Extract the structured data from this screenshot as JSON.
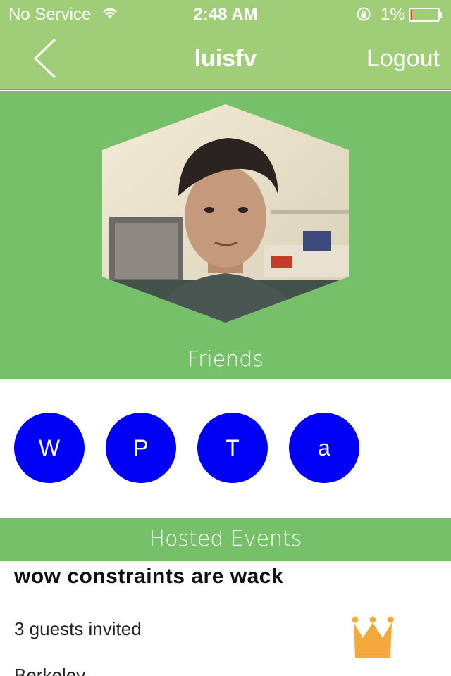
{
  "status_bar": {
    "carrier": "No Service",
    "time": "2:48 AM",
    "battery_percent": "1%",
    "icons": [
      "wifi-icon",
      "lock-rotation-icon",
      "battery-icon"
    ],
    "battery_level": 0.01,
    "battery_color": "#ff3b30"
  },
  "nav": {
    "back_icon": "back-chevron-icon",
    "title": "luisfv",
    "logout_label": "Logout"
  },
  "profile": {
    "avatar_shape": "hexagon"
  },
  "friends": {
    "heading": "Friends",
    "items": [
      {
        "initial": "W"
      },
      {
        "initial": "P"
      },
      {
        "initial": "T"
      },
      {
        "initial": "a"
      }
    ],
    "bubble_color": "#0000f5"
  },
  "hosted_events": {
    "heading": "Hosted Events",
    "items": [
      {
        "title": "wow constraints are wack",
        "guests": "3 guests invited",
        "location": "Berkeley",
        "icon": "crown-icon"
      }
    ]
  },
  "colors": {
    "nav_green": "#9fcd78",
    "section_green": "#76c06a",
    "crown": "#f3a93b"
  }
}
